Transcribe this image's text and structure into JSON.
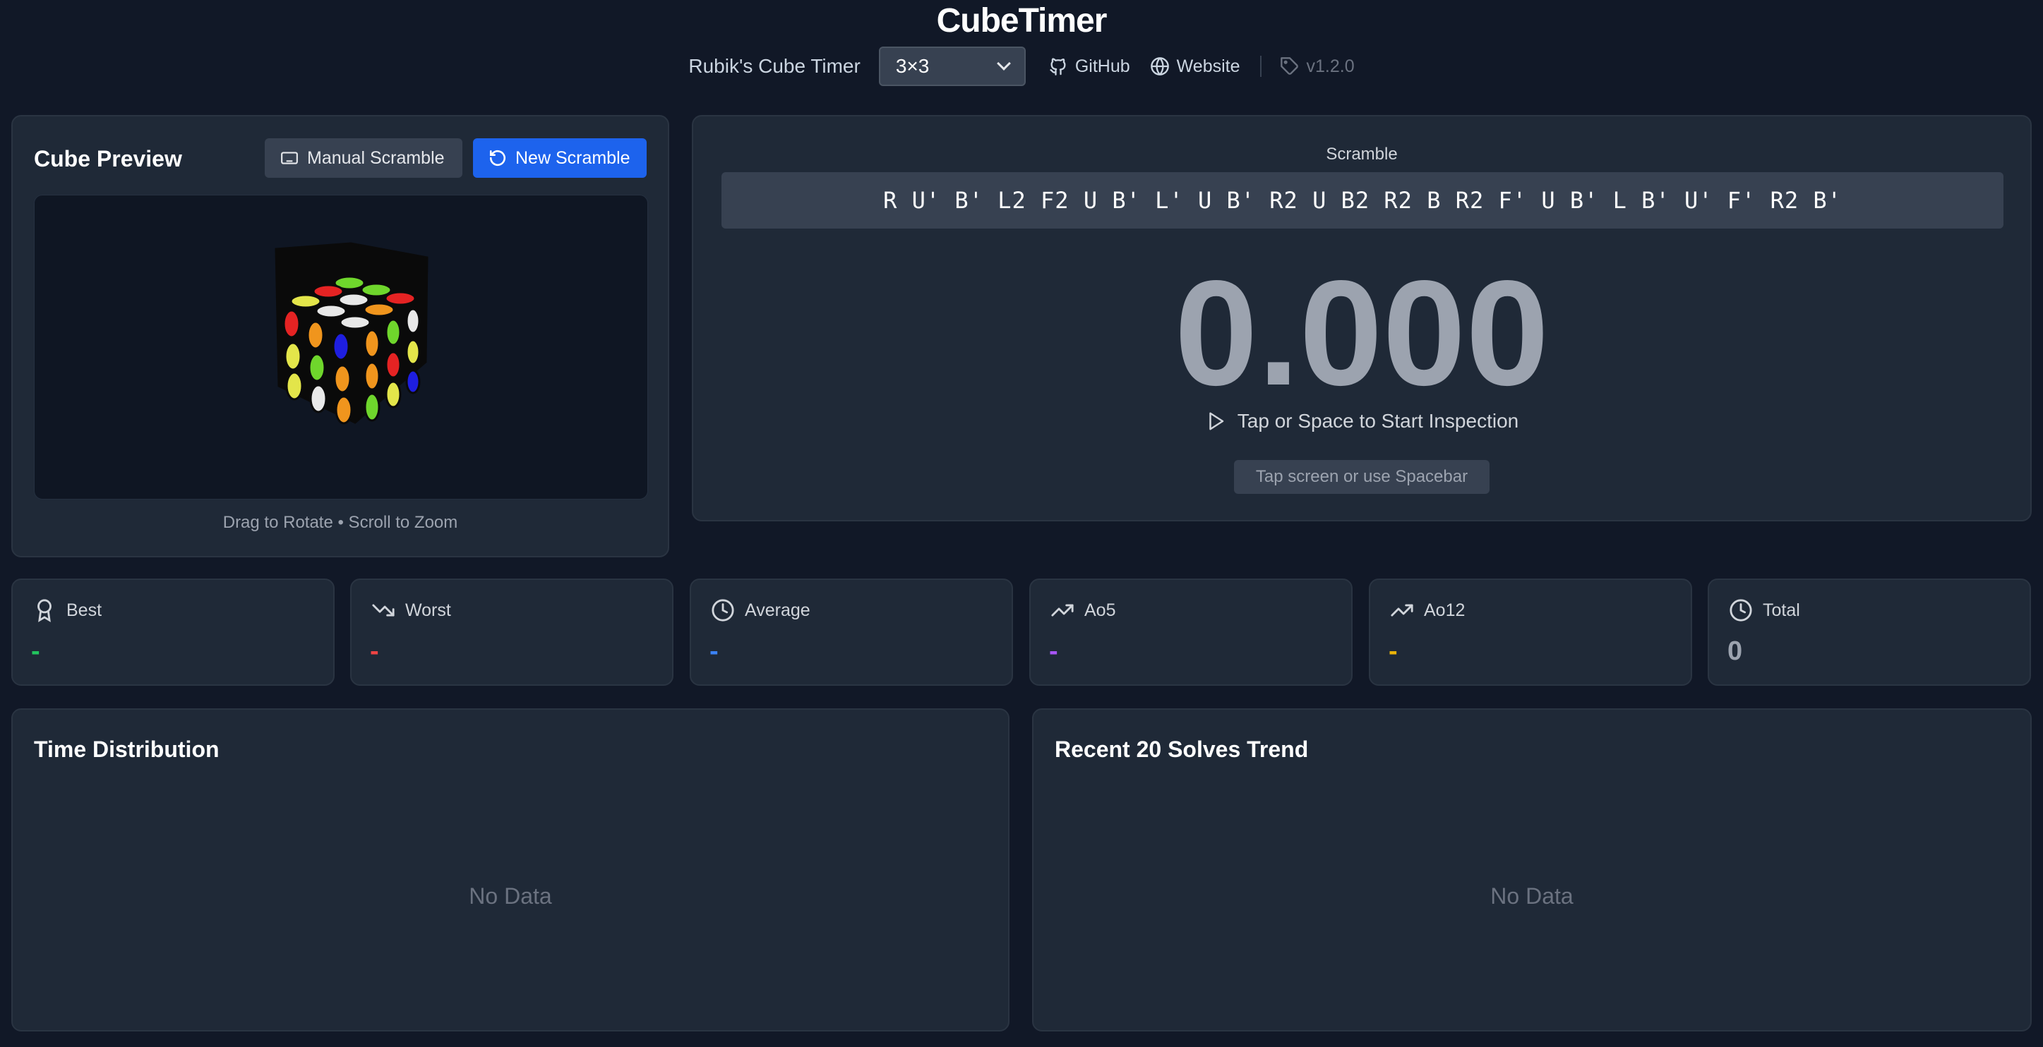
{
  "header": {
    "title": "CubeTimer",
    "subtitle": "Rubik's Cube Timer",
    "puzzle_select": "3×3",
    "github": "GitHub",
    "website": "Website",
    "version": "v1.2.0"
  },
  "preview": {
    "title": "Cube Preview",
    "manual_scramble": "Manual Scramble",
    "new_scramble": "New Scramble",
    "hint": "Drag to Rotate • Scroll to Zoom"
  },
  "timer": {
    "scramble_label": "Scramble",
    "scramble": "R U' B' L2 F2 U B' L' U B' R2 U B2 R2 B R2 F' U B' L B' U' F' R2 B'",
    "time": "0.000",
    "inspection": "Tap or Space to Start Inspection",
    "tap_hint": "Tap screen or use Spacebar"
  },
  "stats": [
    {
      "label": "Best",
      "value": "-",
      "color": "#22c55e",
      "icon": "award-icon"
    },
    {
      "label": "Worst",
      "value": "-",
      "color": "#ef4444",
      "icon": "trending-down-icon"
    },
    {
      "label": "Average",
      "value": "-",
      "color": "#3b82f6",
      "icon": "clock-icon"
    },
    {
      "label": "Ao5",
      "value": "-",
      "color": "#a855f7",
      "icon": "trending-up-icon"
    },
    {
      "label": "Ao12",
      "value": "-",
      "color": "#eab308",
      "icon": "trending-up-icon"
    },
    {
      "label": "Total",
      "value": "0",
      "color": "#9ca3af",
      "icon": "clock-icon"
    }
  ],
  "charts": {
    "distribution_title": "Time Distribution",
    "trend_title": "Recent 20 Solves Trend",
    "distribution_empty": "No Data",
    "trend_empty": "No Data"
  }
}
